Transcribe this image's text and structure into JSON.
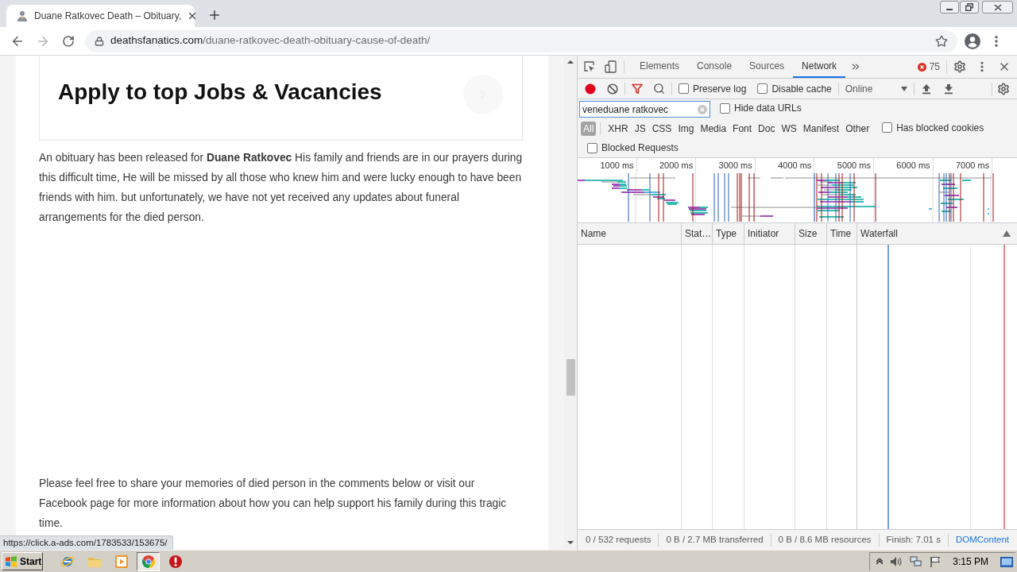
{
  "browser": {
    "tabs": [
      {
        "title": "Duane Ratkovec Death – Obituary,",
        "selected": true
      }
    ],
    "address": {
      "domain": "deathsfanatics.com",
      "path": "/duane-ratkovec-death-obituary-cause-of-death/"
    }
  },
  "page": {
    "ad_heading": "Apply to top Jobs & Vacancies",
    "paragraphs": [
      "An obituary has been released for **Duane Ratkovec** His family and friends are in our prayers during this difficult time, He will be missed by all those who knew him and were lucky enough to have been friends with him. but unfortunately, we have not yet received any updates about funeral arrangements for the died person.",
      "Please feel free to share your memories of died person in the comments below or visit our Facebook page for more information about how you can help support his family during this tragic time."
    ],
    "status_link": "https://click.a-ads.com/1783533/153675/"
  },
  "devtools": {
    "panels": [
      {
        "label": "Elements",
        "selected": false
      },
      {
        "label": "Console",
        "selected": false
      },
      {
        "label": "Sources",
        "selected": false
      },
      {
        "label": "Network",
        "selected": true
      }
    ],
    "error_count": "75",
    "recording": true,
    "preserve_log": {
      "label": "Preserve log",
      "checked": false
    },
    "disable_cache": {
      "label": "Disable cache",
      "checked": false
    },
    "throttling": "Online",
    "filter": {
      "value": "veneduane ratkovec"
    },
    "hide_data_urls": {
      "label": "Hide data URLs",
      "checked": false
    },
    "type_filters": [
      {
        "label": "All",
        "selected": true
      },
      {
        "label": "XHR",
        "selected": false
      },
      {
        "label": "JS",
        "selected": false
      },
      {
        "label": "CSS",
        "selected": false
      },
      {
        "label": "Img",
        "selected": false
      },
      {
        "label": "Media",
        "selected": false
      },
      {
        "label": "Font",
        "selected": false
      },
      {
        "label": "Doc",
        "selected": false
      },
      {
        "label": "WS",
        "selected": false
      },
      {
        "label": "Manifest",
        "selected": false
      },
      {
        "label": "Other",
        "selected": false
      }
    ],
    "has_blocked_cookies": {
      "label": "Has blocked cookies",
      "checked": false
    },
    "blocked_requests": {
      "label": "Blocked Requests",
      "checked": false
    },
    "overview_ticks": [
      "1000 ms",
      "2000 ms",
      "3000 ms",
      "4000 ms",
      "5000 ms",
      "6000 ms",
      "7000 ms"
    ],
    "columns": [
      "Name",
      "Stat…",
      "Type",
      "Initiator",
      "Size",
      "Time",
      "Waterfall"
    ],
    "summary": [
      {
        "text": "0 / 532 requests",
        "kind": "stat"
      },
      {
        "text": "0 B / 2.7 MB transferred",
        "kind": "stat"
      },
      {
        "text": "0 B / 8.6 MB resources",
        "kind": "stat"
      },
      {
        "text": "Finish: 7.01 s",
        "kind": "stat"
      },
      {
        "text": "DOMContent",
        "kind": "domcontentloaded"
      }
    ]
  },
  "taskbar": {
    "start": "Start",
    "apps": [
      {
        "kind": "globe",
        "selected": false
      },
      {
        "kind": "folder",
        "selected": false
      },
      {
        "kind": "media",
        "selected": false
      },
      {
        "kind": "browser",
        "selected": true
      },
      {
        "kind": "alert",
        "selected": false
      }
    ],
    "clock": "3:15 PM"
  }
}
